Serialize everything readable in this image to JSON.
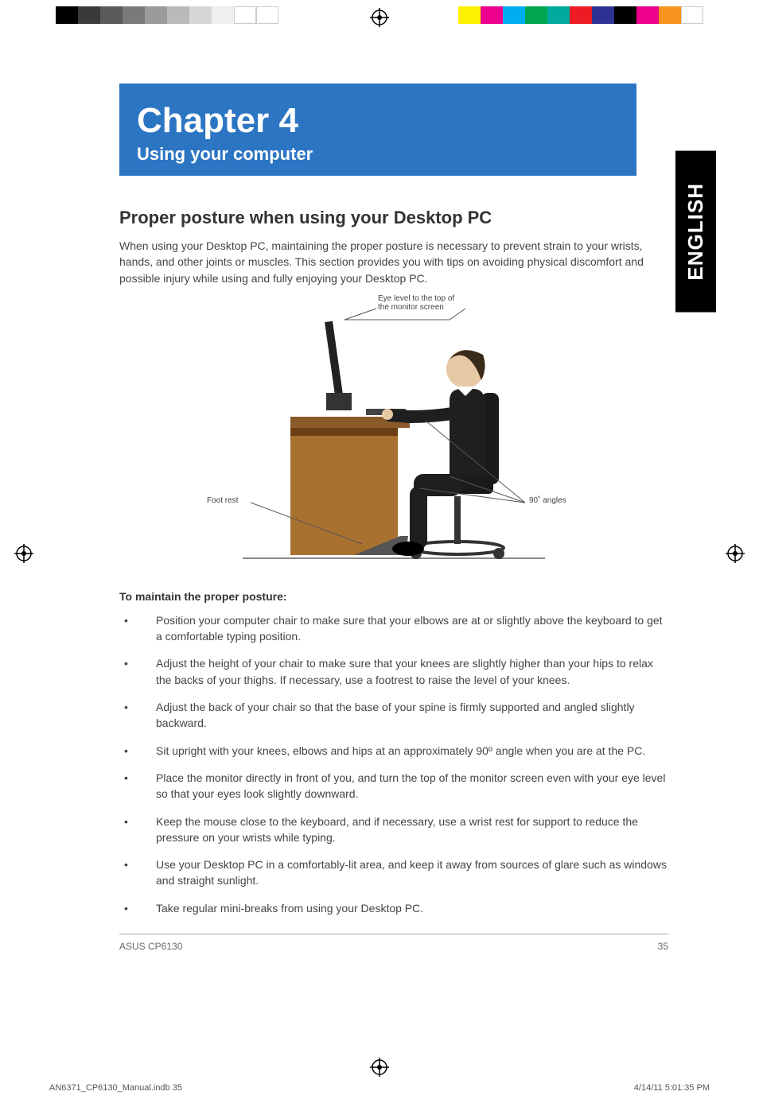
{
  "colorbar": {
    "left": [
      "#000000",
      "#3a3a3a",
      "#5a5a5a",
      "#7a7a7a",
      "#9a9a9a",
      "#bababa",
      "#d6d6d6",
      "#efefef",
      "#ffffff",
      "#ffffff"
    ],
    "right": [
      "#fff200",
      "#ec008c",
      "#00aeef",
      "#00a651",
      "#00a99d",
      "#ed1c24",
      "#2e3192",
      "#000000",
      "#ec008c",
      "#f7941d",
      "#ffffff"
    ]
  },
  "languageTab": "ENGLISH",
  "chapter": {
    "title": "Chapter 4",
    "subtitle": "Using your computer"
  },
  "section": {
    "title": "Proper posture when using your Desktop PC",
    "intro": "When using your Desktop PC, maintaining the proper posture is necessary to prevent strain to your wrists, hands, and other joints or muscles. This section provides you with tips on avoiding physical discomfort and possible injury while using and fully enjoying your Desktop PC."
  },
  "figure": {
    "eyeLabel": "Eye level to the top of the monitor screen",
    "footLabel": "Foot rest",
    "angleLabel": "90˚ angles"
  },
  "listHeading": "To maintain the proper posture:",
  "bullets": [
    "Position your computer chair to make sure that your elbows are at or slightly above the keyboard to get a comfortable typing position.",
    "Adjust the height of your chair to make sure that your knees are slightly higher than your hips to relax the backs of your thighs. If necessary, use a footrest to raise the level of your knees.",
    "Adjust the back of your chair so that the base of your spine is firmly supported and angled slightly backward.",
    "Sit upright with your knees, elbows and hips at an approximately 90º angle when you are at the PC.",
    "Place the monitor directly in front of you, and turn the top of the monitor screen even with your eye level so that your eyes look slightly downward.",
    "Keep the mouse close to the keyboard, and if necessary, use a wrist rest for support to reduce the pressure on your wrists while typing.",
    "Use your Desktop PC in a comfortably-lit area, and keep it away from sources of glare such as windows and straight sunlight.",
    "Take regular mini-breaks from using your Desktop PC."
  ],
  "footer": {
    "left": "ASUS CP6130",
    "right": "35"
  },
  "printFooter": {
    "left": "AN6371_CP6130_Manual.indb   35",
    "right": "4/14/11   5:01:35 PM"
  }
}
